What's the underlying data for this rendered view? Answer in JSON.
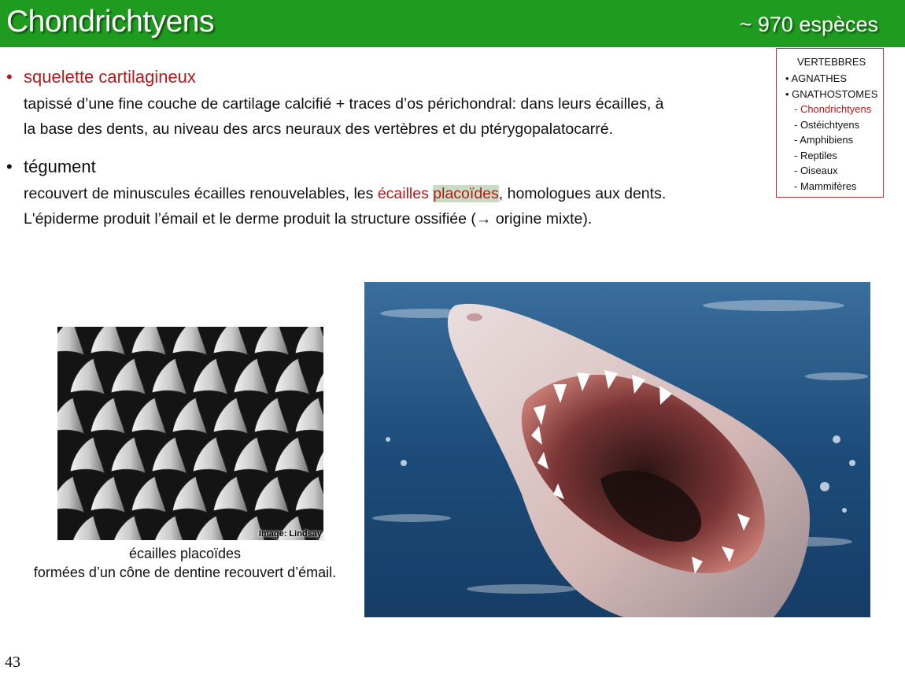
{
  "header": {
    "title": "Chondrichtyens",
    "species_count": "~ 970 espèces"
  },
  "bullets": [
    {
      "label": "squelette cartilagineux",
      "lines": [
        "tapissé d’une fine couche de cartilage calcifié + traces d’os périchondral: dans leurs écailles, à",
        "la base des dents, au niveau des arcs neuraux des vertèbres et du ptérygopalatocarré."
      ]
    },
    {
      "label": "tégument",
      "line1_pre": "recouvert de minuscules écailles renouvelables, les ",
      "line1_red": "écailles ",
      "line1_hl": "placoïdes",
      "line1_post": ", homologues aux dents.",
      "line2": "L'épiderme produit l’émail et le derme produit la structure ossifiée (→ origine mixte)."
    }
  ],
  "nav": {
    "title": "VERTEBBRES",
    "items": [
      "• AGNATHES",
      "• GNATHOSTOMES",
      "- Chondrichtyens",
      "- Ostéichtyens",
      "- Amphibiens",
      "- Reptiles",
      "- Oiseaux",
      "- Mammifères"
    ],
    "active_index": 2
  },
  "figure_scales": {
    "credit": "Image: Lindsay",
    "caption_line1": "écailles placoïdes",
    "caption_line2": "formées d’un cône de dentine recouvert d’émail."
  },
  "page_number": "43",
  "colors": {
    "header_green": "#1f9b1f",
    "accent_red": "#b31a1a",
    "nav_border": "#c0393b"
  }
}
